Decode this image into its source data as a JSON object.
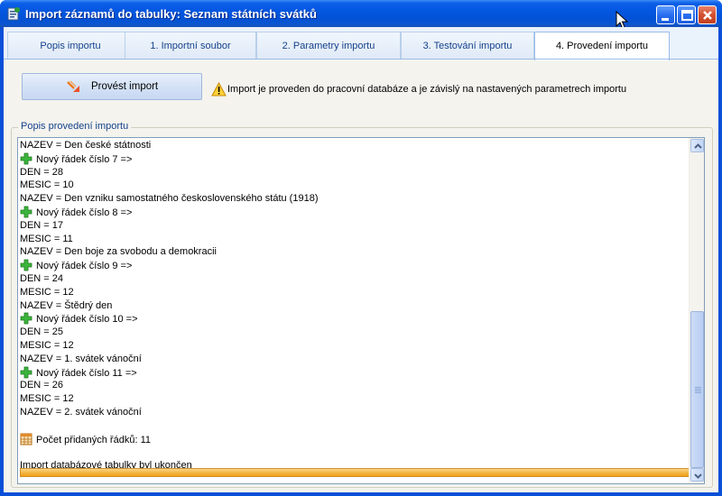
{
  "window": {
    "title": "Import záznamů do tabulky: Seznam státních svátků",
    "accent": "#0a4fd8"
  },
  "tabs": [
    {
      "label": "Popis importu",
      "active": false
    },
    {
      "label": "1. Importní soubor",
      "active": false
    },
    {
      "label": "2. Parametry importu",
      "active": false
    },
    {
      "label": "3. Testování importu",
      "active": false
    },
    {
      "label": "4. Provedení importu",
      "active": true
    }
  ],
  "toolbar": {
    "run_button_label": "Provést import",
    "warning_text": "Import je proveden do pracovní databáze a je závislý na nastavených parametrech importu"
  },
  "log": {
    "group_label": "Popis provedení importu",
    "lines": [
      {
        "text": "NAZEV = Den české státnosti",
        "icon": ""
      },
      {
        "text": "Nový řádek číslo 7 =>",
        "icon": "plus-icon"
      },
      {
        "text": "DEN = 28",
        "icon": ""
      },
      {
        "text": "MESIC = 10",
        "icon": ""
      },
      {
        "text": "NAZEV = Den vzniku samostatného československého státu (1918)",
        "icon": ""
      },
      {
        "text": "Nový řádek číslo 8 =>",
        "icon": "plus-icon"
      },
      {
        "text": "DEN = 17",
        "icon": ""
      },
      {
        "text": "MESIC = 11",
        "icon": ""
      },
      {
        "text": "NAZEV = Den boje za svobodu a demokracii",
        "icon": ""
      },
      {
        "text": "Nový řádek číslo 9 =>",
        "icon": "plus-icon"
      },
      {
        "text": "DEN = 24",
        "icon": ""
      },
      {
        "text": "MESIC = 12",
        "icon": ""
      },
      {
        "text": "NAZEV = Štědrý den",
        "icon": ""
      },
      {
        "text": "Nový řádek číslo 10 =>",
        "icon": "plus-icon"
      },
      {
        "text": "DEN = 25",
        "icon": ""
      },
      {
        "text": "MESIC = 12",
        "icon": ""
      },
      {
        "text": "NAZEV = 1. svátek vánoční",
        "icon": ""
      },
      {
        "text": "Nový řádek číslo 11 =>",
        "icon": "plus-icon"
      },
      {
        "text": "DEN = 26",
        "icon": ""
      },
      {
        "text": "MESIC = 12",
        "icon": ""
      },
      {
        "text": "NAZEV = 2. svátek vánoční",
        "icon": ""
      },
      {
        "text": "",
        "icon": ""
      },
      {
        "text": "Počet přidaných řádků: 11",
        "icon": "table-icon"
      },
      {
        "text": "",
        "icon": ""
      },
      {
        "text": "Import databázové tabulky byl ukončen",
        "icon": ""
      }
    ]
  }
}
